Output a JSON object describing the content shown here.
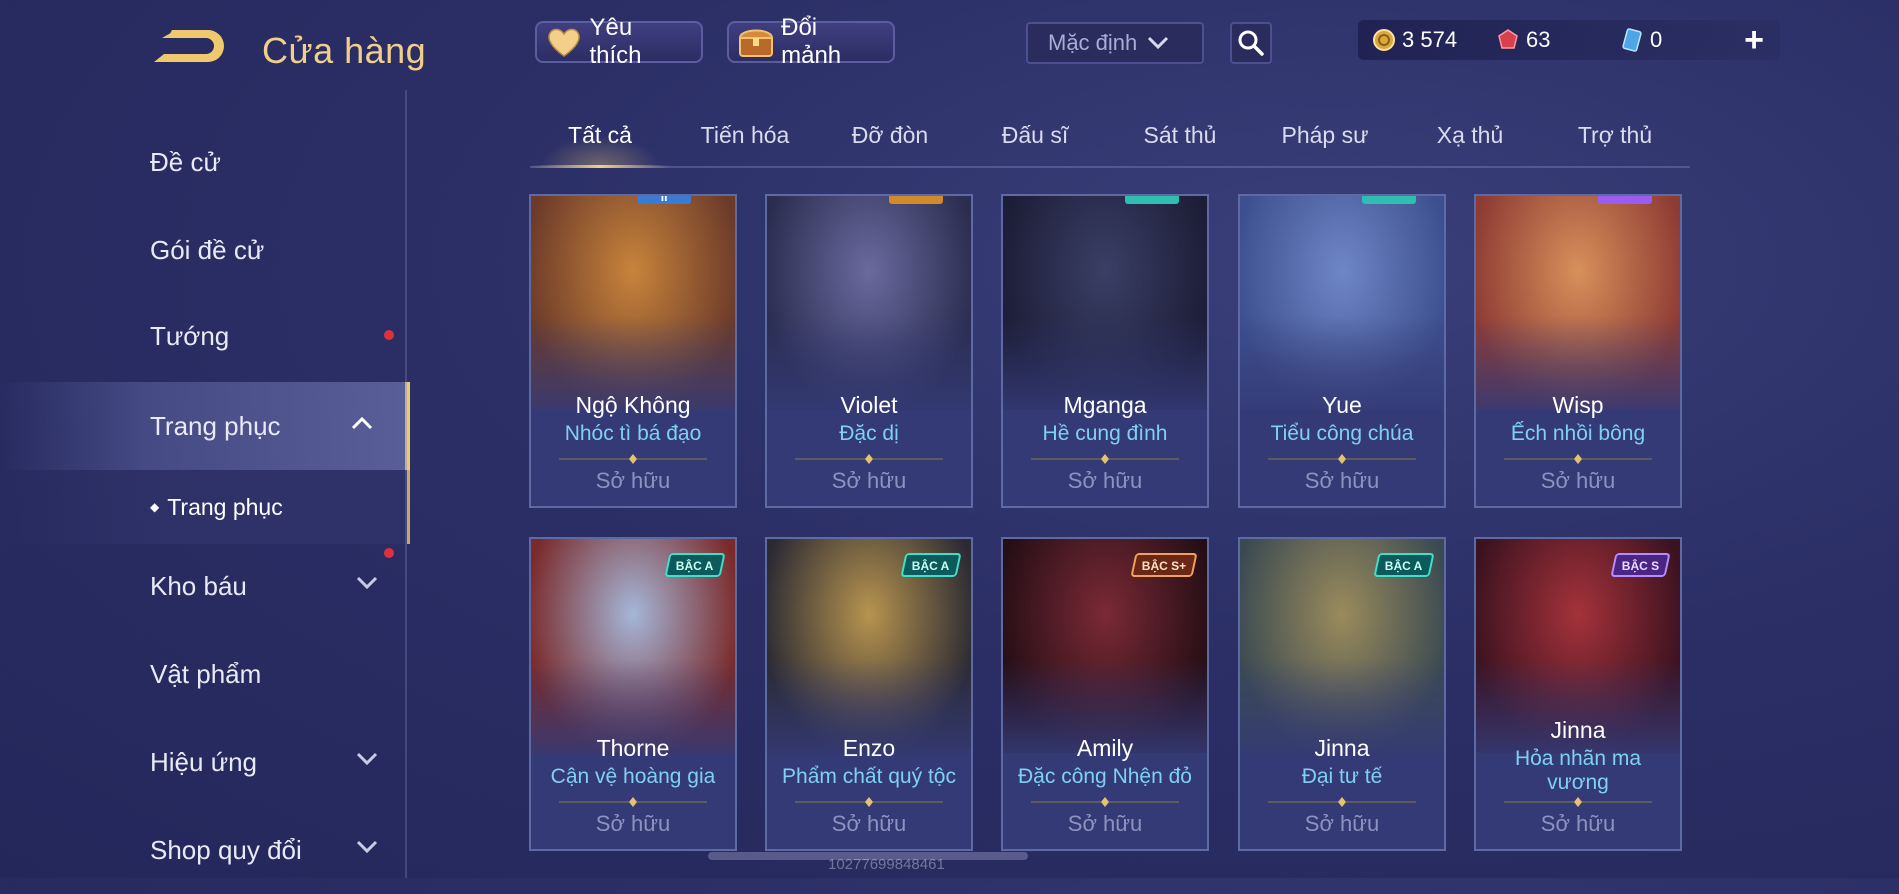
{
  "header": {
    "title": "Cửa hàng",
    "favorite_label": "Yêu thích",
    "exchange_label": "Đổi mảnh",
    "sort_selected": "Mặc định",
    "currency": {
      "gold": "3 574",
      "voucher": "63",
      "ticket": "0"
    },
    "plus": "+"
  },
  "sidebar": {
    "items": [
      {
        "label": "Đề cử"
      },
      {
        "label": "Gói đề cử"
      },
      {
        "label": "Tướng"
      },
      {
        "label": "Trang phục"
      },
      {
        "label": "Kho báu"
      },
      {
        "label": "Vật phẩm"
      },
      {
        "label": "Hiệu ứng"
      },
      {
        "label": "Shop quy đổi"
      }
    ],
    "sub_item": {
      "bullet": "◆",
      "label": "Trang phục"
    }
  },
  "tabs": [
    {
      "label": "Tất cả"
    },
    {
      "label": "Tiến hóa"
    },
    {
      "label": "Đỡ đòn"
    },
    {
      "label": "Đấu sĩ"
    },
    {
      "label": "Sát thủ"
    },
    {
      "label": "Pháp sư"
    },
    {
      "label": "Xạ thủ"
    },
    {
      "label": "Trợ thủ"
    }
  ],
  "cards": [
    {
      "hero": "Ngộ Không",
      "skin": "Nhóc tì bá đạo",
      "status": "Sở hữu",
      "badge_top": "II",
      "colors": [
        "#c8843b",
        "#6b3a2a"
      ]
    },
    {
      "hero": "Violet",
      "skin": "Đặc dị",
      "status": "Sở hữu",
      "colors": [
        "#6a6a9e",
        "#2a2d50"
      ]
    },
    {
      "hero": "Mganga",
      "skin": "Hề cung đình",
      "status": "Sở hữu",
      "colors": [
        "#3a3f66",
        "#1c1d36"
      ]
    },
    {
      "hero": "Yue",
      "skin": "Tiểu công chúa",
      "status": "Sở hữu",
      "colors": [
        "#6f86c6",
        "#3d4f8e"
      ]
    },
    {
      "hero": "Wisp",
      "skin": "Ếch nhồi bông",
      "status": "Sở hữu",
      "colors": [
        "#d8905a",
        "#8e3b34"
      ]
    },
    {
      "hero": "Thorne",
      "skin": "Cận vệ hoàng gia",
      "status": "Sở hữu",
      "badge": "BẬC A",
      "badge_type": "a",
      "colors": [
        "#a5b6d8",
        "#7a2a2a"
      ]
    },
    {
      "hero": "Enzo",
      "skin": "Phẩm chất quý tộc",
      "status": "Sở hữu",
      "badge": "BẬC A",
      "badge_type": "a",
      "colors": [
        "#b7944f",
        "#2b2a33"
      ]
    },
    {
      "hero": "Amily",
      "skin": "Đặc công Nhện đỏ",
      "status": "Sở hữu",
      "badge": "BẬC S+",
      "badge_type": "splus",
      "colors": [
        "#7a2a35",
        "#260e16"
      ]
    },
    {
      "hero": "Jinna",
      "skin": "Đại tư tế",
      "status": "Sở hữu",
      "badge": "BẬC A",
      "badge_type": "a",
      "colors": [
        "#9a8b5c",
        "#3b4a52"
      ]
    },
    {
      "hero": "Jinna",
      "skin": "Hỏa nhãn ma vương",
      "status": "Sở hữu",
      "badge": "BẬC S",
      "badge_type": "s",
      "colors": [
        "#a4323a",
        "#3b1220"
      ]
    }
  ],
  "watermark": "10277699848461",
  "colors": {
    "gold": "#f1cf8a",
    "skin_name": "#7fd0f3",
    "active_border": "#e9c77b"
  },
  "icons": {
    "back": "back-arrow-icon",
    "favorite": "heart-icon",
    "exchange": "treasure-chest-icon",
    "search": "search-icon",
    "gold": "gold-coin-icon",
    "voucher": "red-gem-icon",
    "ticket": "ticket-icon"
  }
}
